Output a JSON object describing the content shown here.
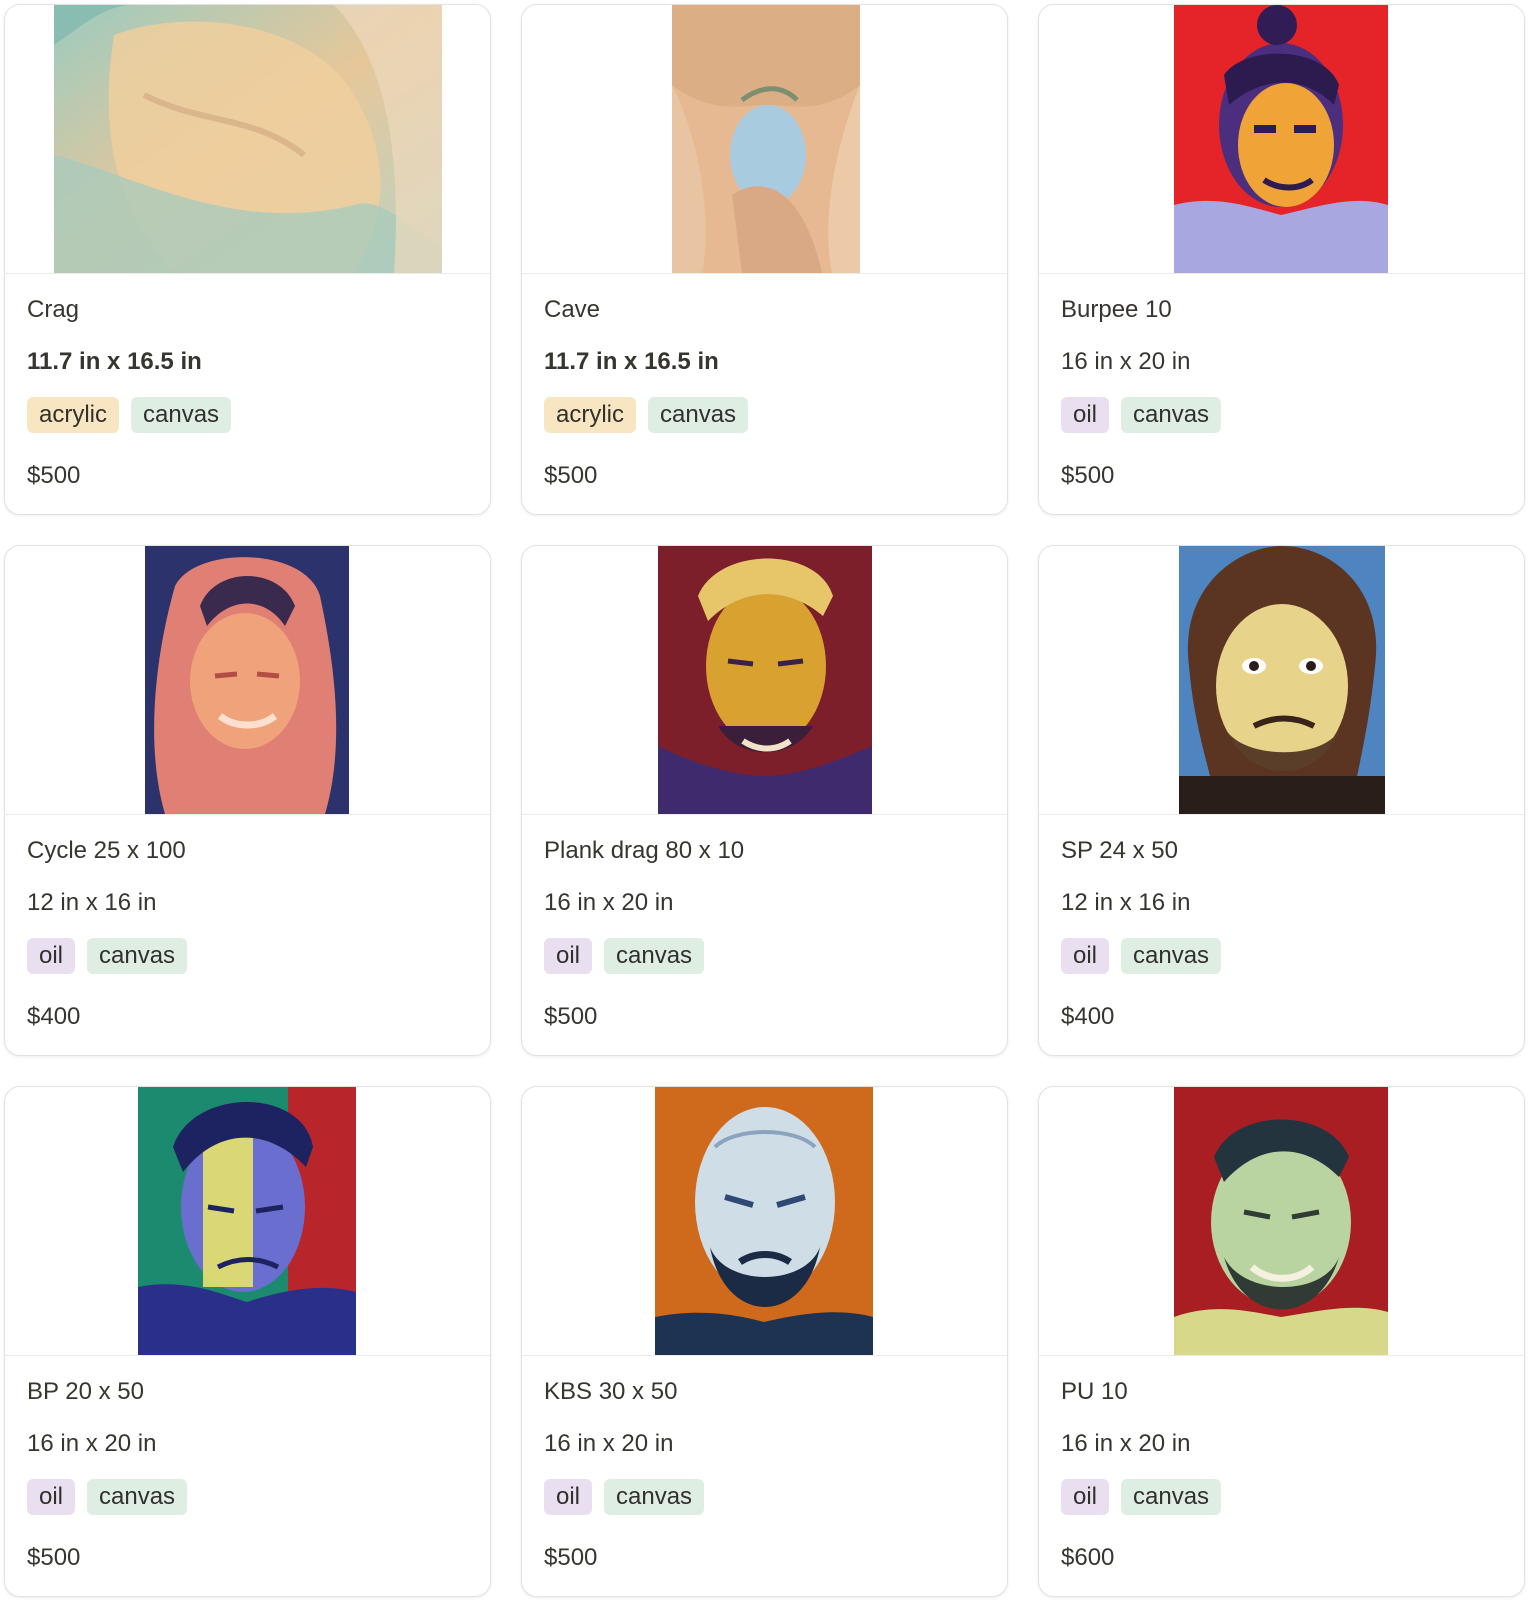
{
  "colors": {
    "tag_acrylic": "#f8e6c2",
    "tag_oil": "#eadff0",
    "tag_canvas": "#dfeee3"
  },
  "cards": [
    {
      "title": "Crag",
      "size": "11.7 in x 16.5 in",
      "tags": [
        "acrylic",
        "canvas"
      ],
      "price": "$500"
    },
    {
      "title": "Cave",
      "size": "11.7 in x 16.5 in",
      "tags": [
        "acrylic",
        "canvas"
      ],
      "price": "$500"
    },
    {
      "title": "Burpee 10",
      "size": "16 in x 20 in",
      "tags": [
        "oil",
        "canvas"
      ],
      "price": "$500"
    },
    {
      "title": "Cycle 25 x 100",
      "size": "12 in x 16 in",
      "tags": [
        "oil",
        "canvas"
      ],
      "price": "$400"
    },
    {
      "title": "Plank drag 80 x 10",
      "size": "16 in x 20 in",
      "tags": [
        "oil",
        "canvas"
      ],
      "price": "$500"
    },
    {
      "title": "SP 24 x 50",
      "size": "12 in x 16 in",
      "tags": [
        "oil",
        "canvas"
      ],
      "price": "$400"
    },
    {
      "title": "BP 20 x 50",
      "size": "16 in x 20 in",
      "tags": [
        "oil",
        "canvas"
      ],
      "price": "$500"
    },
    {
      "title": "KBS 30 x 50",
      "size": "16 in x 20 in",
      "tags": [
        "oil",
        "canvas"
      ],
      "price": "$500"
    },
    {
      "title": "PU 10",
      "size": "16 in x 20 in",
      "tags": [
        "oil",
        "canvas"
      ],
      "price": "$600"
    }
  ]
}
